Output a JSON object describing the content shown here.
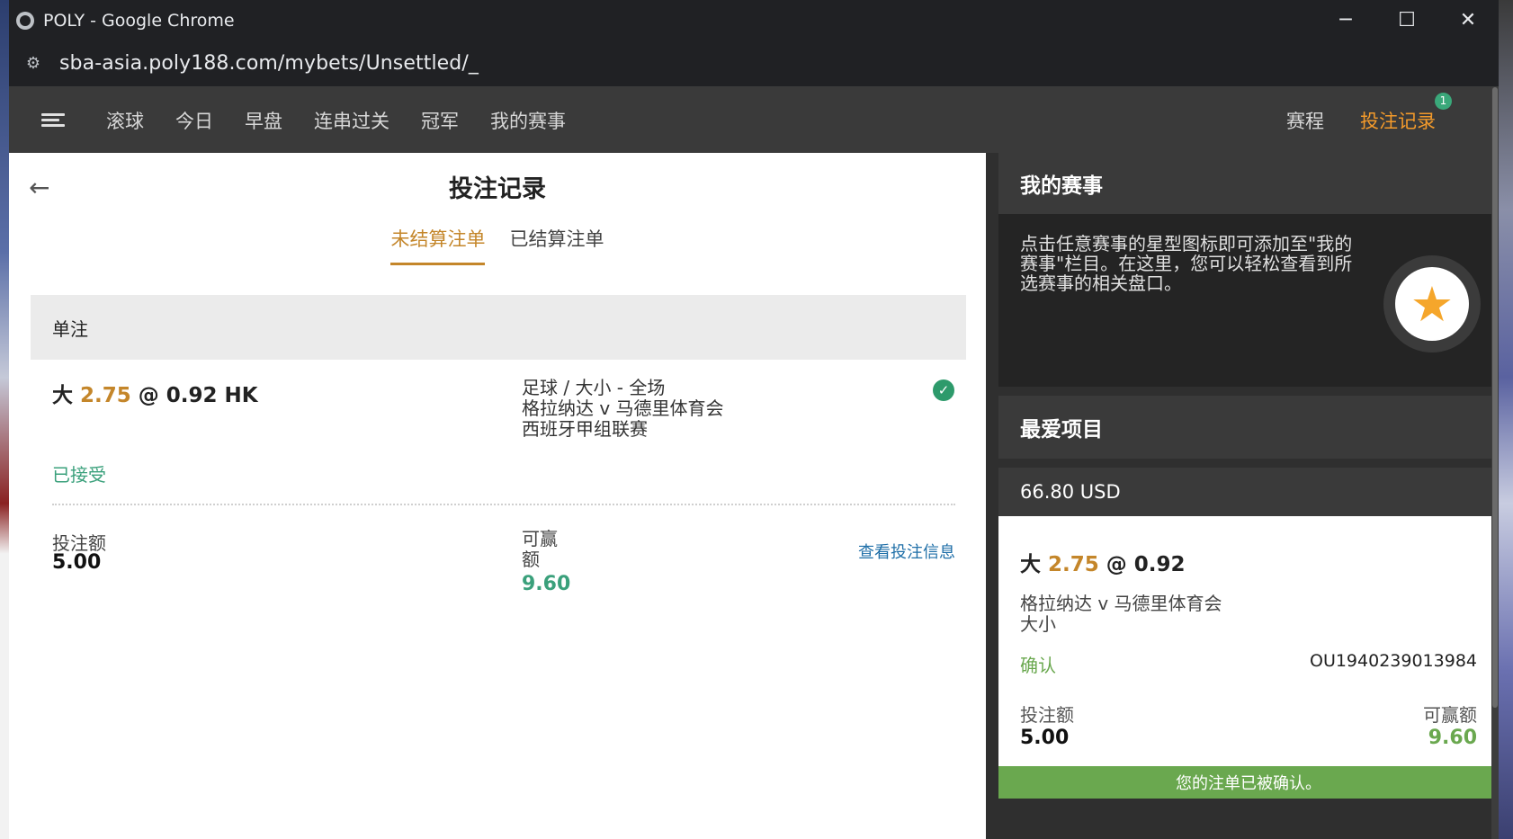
{
  "window": {
    "title": "POLY - Google Chrome",
    "url": "sba-asia.poly188.com/mybets/Unsettled/_",
    "controls": {
      "minimize": "─",
      "maximize": "☐",
      "close": "✕"
    }
  },
  "nav": {
    "items": [
      "滚球",
      "今日",
      "早盘",
      "连串过关",
      "冠军",
      "我的赛事"
    ],
    "schedule": "赛程",
    "bet_record": "投注记录",
    "badge": "1"
  },
  "main": {
    "title": "投注记录",
    "tabs": [
      {
        "label": "未结算注单",
        "active": true
      },
      {
        "label": "已结算注单",
        "active": false
      }
    ],
    "section": "单注",
    "bet": {
      "selection": "大",
      "handicap": "2.75",
      "at": "@",
      "odds": "0.92 HK",
      "sport_market": "足球 / 大小 - 全场",
      "match": "格拉纳达 v 马德里体育会",
      "league": "西班牙甲组联赛",
      "status": "已接受",
      "stake_label": "投注额",
      "stake": "5.00",
      "win_label": "可赢额",
      "win": "9.60",
      "view_link": "查看投注信息"
    }
  },
  "right": {
    "my_events_title": "我的赛事",
    "my_events_text": "点击任意赛事的星型图标即可添加至\"我的赛事\"栏目。在这里，您可以轻松查看到所选赛事的相关盘口。",
    "favorites_title": "最爱项目",
    "balance": "66.80 USD",
    "slip": {
      "selection": "大",
      "handicap": "2.75",
      "at": "@",
      "odds": "0.92",
      "match": "格拉纳达 v 马德里体育会",
      "market": "大小",
      "confirm": "确认",
      "ref": "OU1940239013984",
      "stake_label": "投注额",
      "stake": "5.00",
      "win_label": "可赢额",
      "win": "9.60",
      "confirmed_msg": "您的注单已被确认。"
    }
  },
  "colors": {
    "accent": "#c4862a",
    "nav_active": "#f39a2b",
    "green": "#3aa07b",
    "confirm_green": "#6aa84f"
  }
}
